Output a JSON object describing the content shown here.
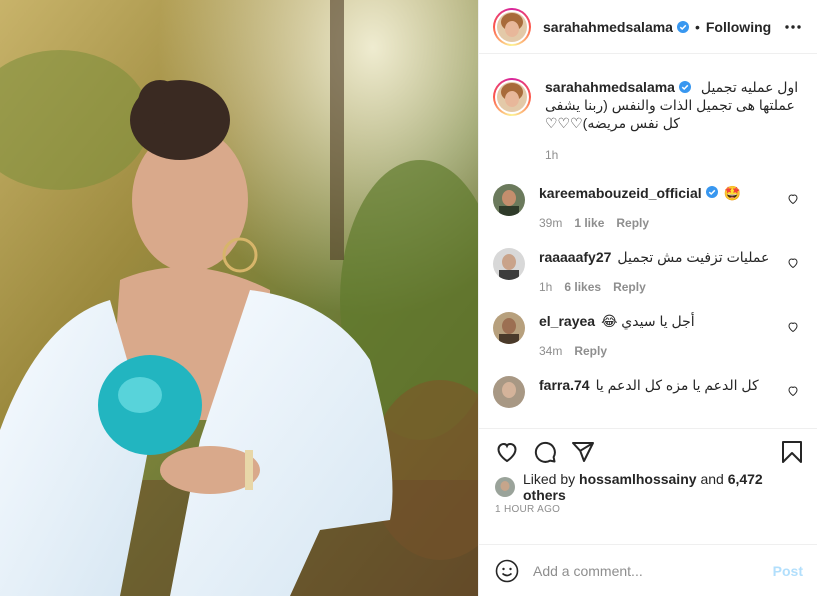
{
  "post": {
    "username": "sarahahmedsalama",
    "separator": "•",
    "follow_status": "Following",
    "more_icon": "more-horizontal-icon"
  },
  "caption": {
    "username": "sarahahmedsalama",
    "line1": "اول عمليه تجميل",
    "line2": "عملتها هى تجميل الذات والنفس (ربنا يشفى",
    "line3": "كل نفس مريضه)♡♡♡",
    "time": "1h"
  },
  "comments": [
    {
      "username": "kareemabouzeid_official",
      "verified": true,
      "text": "🤩",
      "time": "39m",
      "likes": "1 like",
      "reply": "Reply"
    },
    {
      "username": "raaaaafy27",
      "verified": false,
      "text": "عمليات تزفيت مش تجميل",
      "time": "1h",
      "likes": "6 likes",
      "reply": "Reply"
    },
    {
      "username": "el_rayea",
      "verified": false,
      "text": "أجل يا سيدي 😂",
      "time": "34m",
      "likes": "",
      "reply": "Reply"
    },
    {
      "username": "farra.74",
      "verified": false,
      "text": "كل الدعم يا مزه كل الدعم يا",
      "time": "",
      "likes": "",
      "reply": ""
    }
  ],
  "likes": {
    "prefix": "Liked by",
    "user": "hossamlhossainy",
    "conj": "and",
    "others": "6,472 others"
  },
  "time_ago": "1 HOUR AGO",
  "add_comment": {
    "placeholder": "Add a comment...",
    "post_label": "Post"
  },
  "colors": {
    "verified": "#3897f0",
    "post_disabled": "#b2dffc",
    "muted": "#8e8e8e"
  }
}
